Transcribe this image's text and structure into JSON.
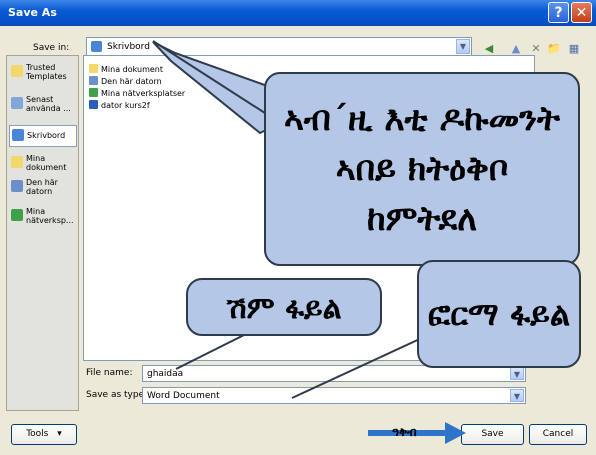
{
  "window": {
    "title": "Save As",
    "help_glyph": "?",
    "close_glyph": "✕"
  },
  "toolbar": {
    "save_in_label": "Save in:",
    "save_in_value": "Skrivbord",
    "back_glyph": "◀",
    "up_glyph": "▲",
    "delete_glyph": "✕",
    "new_folder_glyph": "📁",
    "views_glyph": "▦",
    "dropdown_glyph": "▼"
  },
  "places": [
    {
      "label": "Trusted Templates",
      "icon": "folder-icon",
      "color": "#f2d86a"
    },
    {
      "label": "Senast använda ...",
      "icon": "recent-icon",
      "color": "#7fa7d8"
    },
    {
      "label": "Skrivbord",
      "icon": "desktop-icon",
      "color": "#4a86d6",
      "selected": true
    },
    {
      "label": "Mina dokument",
      "icon": "documents-icon",
      "color": "#f2d86a"
    },
    {
      "label": "Den här datorn",
      "icon": "computer-icon",
      "color": "#6d8fc9"
    },
    {
      "label": "Mina nätverksp...",
      "icon": "network-icon",
      "color": "#3fa04a"
    }
  ],
  "files": [
    {
      "name": "Mina dokument",
      "icon": "documents-icon",
      "color": "#f2d86a"
    },
    {
      "name": "Den här datorn",
      "icon": "computer-icon",
      "color": "#6d8fc9"
    },
    {
      "name": "Mina nätverksplatser",
      "icon": "network-icon",
      "color": "#3fa04a"
    },
    {
      "name": "dator kurs2f",
      "icon": "word-doc-icon",
      "color": "#2b5eb8"
    }
  ],
  "form": {
    "file_name_label": "File name:",
    "file_name_value": "ghaidaa",
    "save_as_type_label": "Save as type:",
    "save_as_type_value": "Word Document"
  },
  "buttons": {
    "tools": "Tools",
    "tools_arrow": "▾",
    "save": "Save",
    "cancel": "Cancel"
  },
  "annotations": {
    "bubble_main": "ኣብ´ዚ እቲ ዶኩመንት ኣበይ ክትዕቅቦ ከምትደለ",
    "bubble_name": "ሽም ፋይል",
    "bubble_format": "ፎርማ ፋይል",
    "arrow_label": "ዓቅብ"
  },
  "colors": {
    "bubble_fill": "#b4c7e7",
    "title_bar": "#0a5ad4",
    "arrow": "#2e74c8"
  }
}
